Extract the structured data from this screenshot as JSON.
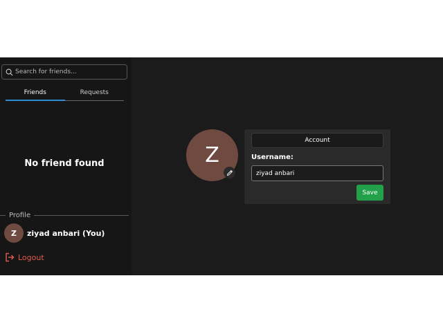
{
  "colors": {
    "sidebar_bg": "#161616",
    "main_bg": "#1b1b1b",
    "active_tab_underline": "#2e8fd8",
    "avatar_bg": "#6e4a40",
    "logout": "#e05c4f",
    "save_button": "#22a14a"
  },
  "sidebar": {
    "search": {
      "placeholder": "Search for friends...",
      "value": "",
      "icon": "search-icon"
    },
    "tabs": [
      {
        "label": "Friends",
        "active": true
      },
      {
        "label": "Requests",
        "active": false
      }
    ],
    "empty_message": "No friend found",
    "profile_section_label": "Profile",
    "current_user": {
      "initial": "Z",
      "name": "ziyad anbari (You)"
    },
    "logout": {
      "label": "Logout",
      "icon": "logout-icon"
    }
  },
  "main": {
    "avatar_initial": "Z",
    "edit_icon": "pencil-icon",
    "account_button": "Account",
    "username_label": "Username:",
    "username_value": "ziyad anbari",
    "save_label": "Save"
  }
}
